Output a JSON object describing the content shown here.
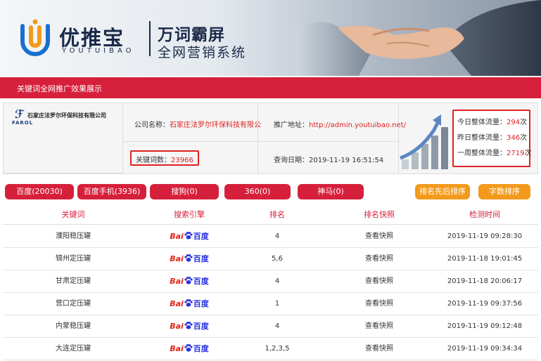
{
  "banner": {
    "brand": "优推宝",
    "brand_en": "YOUTUIBAO",
    "slogan": "万词霸屏",
    "slogan_sub": "全网营销系统"
  },
  "title_bar": "关键词全网推广效果展示",
  "info": {
    "company_logo_text": "FAROL",
    "company_logo_name": "石家庄法罗尔环保科技有限公司",
    "company_label": "公司名称：",
    "company_value": "石家庄法罗尔环保科技有限公",
    "url_label": "推广地址：",
    "url_value": "http://admin.youtuibao.net/",
    "keywords_label": "关键词数：",
    "keywords_value": "23966",
    "date_label": "查询日期：",
    "date_value": "2019-11-19 16:51:54",
    "traffic": [
      {
        "label": "今日整体流量：",
        "value": "294",
        "unit": "次"
      },
      {
        "label": "昨日整体流量：",
        "value": "346",
        "unit": "次"
      },
      {
        "label": "一周整体流量：",
        "value": "2719",
        "unit": "次"
      }
    ]
  },
  "tabs": [
    {
      "label": "百度(20030)"
    },
    {
      "label": "百度手机(3936)"
    },
    {
      "label": "搜狗(0)"
    },
    {
      "label": "360(0)"
    },
    {
      "label": "神马(0)"
    },
    {
      "label": "排名先后排序"
    },
    {
      "label": "字数排序"
    }
  ],
  "table": {
    "headers": [
      "关键词",
      "搜索引擎",
      "排名",
      "排名快照",
      "检测时间"
    ],
    "engine_text": {
      "bai": "Bai",
      "du": "百度"
    },
    "rows": [
      {
        "keyword": "濮阳稳压罐",
        "rank": "4",
        "snapshot": "查看快照",
        "time": "2019-11-19 09:28:30"
      },
      {
        "keyword": "锦州定压罐",
        "rank": "5,6",
        "snapshot": "查看快照",
        "time": "2019-11-18 19:01:45"
      },
      {
        "keyword": "甘肃定压罐",
        "rank": "4",
        "snapshot": "查看快照",
        "time": "2019-11-18 20:06:17"
      },
      {
        "keyword": "营口定压罐",
        "rank": "1",
        "snapshot": "查看快照",
        "time": "2019-11-19 09:37:56"
      },
      {
        "keyword": "内蒙稳压罐",
        "rank": "4",
        "snapshot": "查看快照",
        "time": "2019-11-19 09:12:48"
      },
      {
        "keyword": "大连定压罐",
        "rank": "1,2,3,5",
        "snapshot": "查看快照",
        "time": "2019-11-19 09:34:34"
      }
    ]
  },
  "colors": {
    "accent": "#d6203b",
    "orange": "#f39a1d",
    "highlight": "#e02020"
  }
}
